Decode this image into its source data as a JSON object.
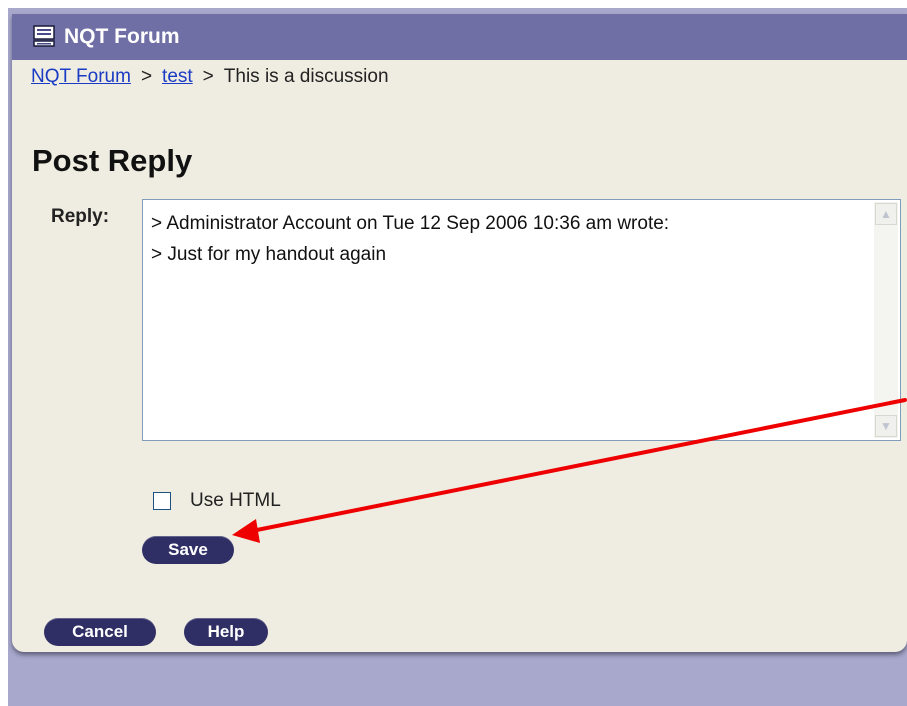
{
  "titlebar": {
    "title": "NQT Forum",
    "icon": "forum-icon"
  },
  "breadcrumb": {
    "items": [
      "NQT Forum",
      "test",
      "This is a discussion"
    ],
    "separator": ">"
  },
  "page": {
    "heading": "Post Reply"
  },
  "reply": {
    "label": "Reply:",
    "value": "> Administrator Account on Tue 12 Sep 2006 10:36 am wrote:\n> Just for my handout again"
  },
  "options": {
    "use_html_label": "Use HTML",
    "use_html_checked": false
  },
  "buttons": {
    "save": "Save",
    "cancel": "Cancel",
    "help": "Help"
  },
  "colors": {
    "titlebar": "#6f6fa5",
    "panel": "#efede1",
    "button": "#2f2f66",
    "link": "#1a3bc4",
    "annotation_arrow": "#ee0000"
  }
}
